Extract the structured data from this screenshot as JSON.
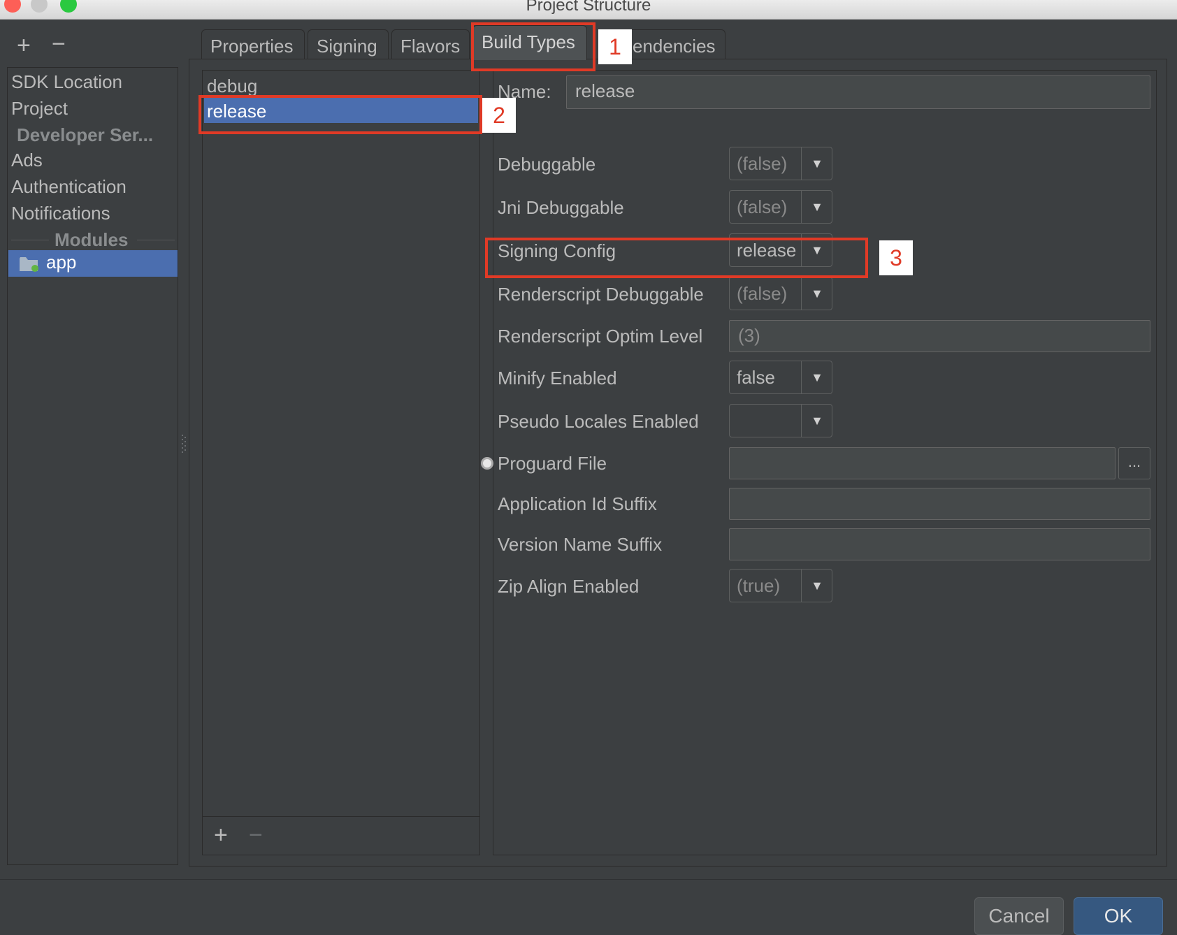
{
  "window": {
    "title": "Project Structure"
  },
  "sidebar": {
    "add_glyph": "+",
    "remove_glyph": "−",
    "items": [
      {
        "label": "SDK Location"
      },
      {
        "label": "Project"
      }
    ],
    "developer_services_header": "Developer Ser...",
    "service_items": [
      {
        "label": "Ads"
      },
      {
        "label": "Authentication"
      },
      {
        "label": "Notifications"
      }
    ],
    "modules_header": "Modules",
    "modules": [
      {
        "label": "app",
        "icon": "module-folder-icon",
        "selected": true
      }
    ]
  },
  "tabs": [
    {
      "label": "Properties"
    },
    {
      "label": "Signing"
    },
    {
      "label": "Flavors"
    },
    {
      "label": "Build Types",
      "active": true
    },
    {
      "label": "endencies"
    }
  ],
  "build_types": {
    "items": [
      {
        "label": "debug"
      },
      {
        "label": "release",
        "selected": true
      }
    ],
    "add_glyph": "+",
    "remove_glyph": "−"
  },
  "form": {
    "name_label": "Name:",
    "name_value": "release",
    "debuggable": {
      "label": "Debuggable",
      "value": "(false)"
    },
    "jni_debuggable": {
      "label": "Jni Debuggable",
      "value": "(false)"
    },
    "signing_config": {
      "label": "Signing Config",
      "value": "release"
    },
    "renderscript_debuggable": {
      "label": "Renderscript Debuggable",
      "value": "(false)"
    },
    "renderscript_optim_level": {
      "label": "Renderscript Optim Level",
      "value": "(3)"
    },
    "minify_enabled": {
      "label": "Minify Enabled",
      "value": "false"
    },
    "pseudo_locales_enabled": {
      "label": "Pseudo Locales Enabled",
      "value": ""
    },
    "proguard_file": {
      "label": "Proguard File",
      "value": "",
      "browse_label": "..."
    },
    "application_id_suffix": {
      "label": "Application Id Suffix",
      "value": ""
    },
    "version_name_suffix": {
      "label": "Version Name Suffix",
      "value": ""
    },
    "zip_align_enabled": {
      "label": "Zip Align Enabled",
      "value": "(true)"
    },
    "dropdown_arrow": "▼"
  },
  "annotations": {
    "callout_1": "1",
    "callout_2": "2",
    "callout_3": "3",
    "highlight_color": "#e03a26"
  },
  "footer": {
    "cancel_label": "Cancel",
    "ok_label": "OK"
  },
  "colors": {
    "background": "#3c3f41",
    "selection": "#4b6eaf",
    "default_button": "#365880"
  }
}
